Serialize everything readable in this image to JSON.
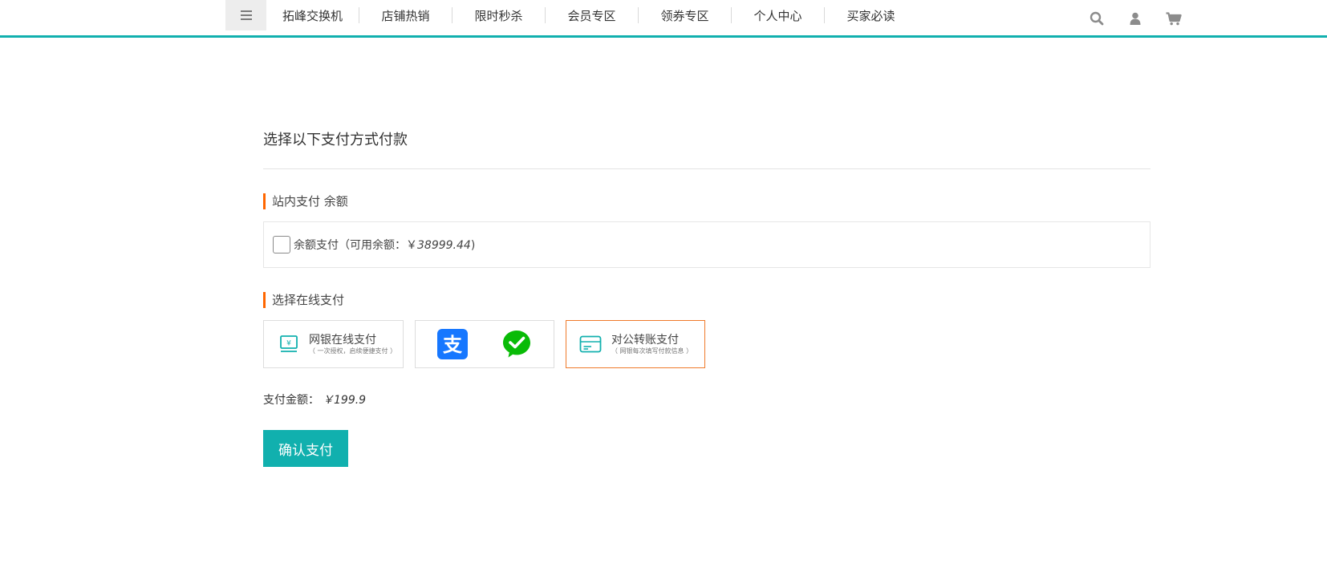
{
  "nav": {
    "items": [
      {
        "label": "拓峰交换机"
      },
      {
        "label": "店铺热销"
      },
      {
        "label": "限时秒杀"
      },
      {
        "label": "会员专区"
      },
      {
        "label": "领券专区"
      },
      {
        "label": "个人中心"
      },
      {
        "label": "买家必读"
      }
    ],
    "icons": [
      "search-icon",
      "user-icon",
      "cart-icon"
    ],
    "accent_color": "#11b0ae"
  },
  "page": {
    "title": "选择以下支付方式付款"
  },
  "balance_section": {
    "title": "站内支付 余额",
    "label": "余额支付（可用余额：￥",
    "amount": "38999.44",
    "suffix": ")",
    "checked": false
  },
  "online_section": {
    "title": "选择在线支付",
    "options": [
      {
        "name": "网银在线支付",
        "sub": "（ 一次授权，启续便捷支付 ）",
        "icon": "bank-card-icon"
      },
      {
        "name": "",
        "sub": "",
        "icons": [
          "alipay-icon",
          "wechat-pay-icon"
        ]
      },
      {
        "name": "对公转账支付",
        "sub": "（ 网银每次填写付款信息 ）",
        "icon": "credit-card-icon",
        "selected": true
      }
    ]
  },
  "payment": {
    "label": "支付金额：",
    "amount": "￥199.9"
  },
  "confirm": {
    "label": "确认支付"
  },
  "colors": {
    "accent": "#11b0ae",
    "highlight": "#ff6600",
    "alipay": "#1677ff",
    "wechat": "#09bb07"
  }
}
